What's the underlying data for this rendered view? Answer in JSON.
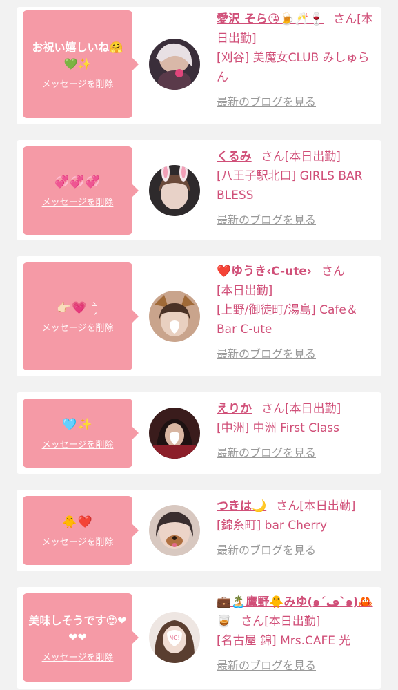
{
  "common": {
    "delete_label": "メッセージを削除",
    "blog_label": "最新のブログを見る",
    "san": "さん"
  },
  "colors": {
    "bubble": "#f59aa6",
    "text_pink": "#d04f78",
    "link_gray": "#9a9a9a",
    "background": "#f2f2f2"
  },
  "items": [
    {
      "message": "お祝い嬉しいね🤗💚✨",
      "name": "愛沢 そら😘🍺🥂🍷",
      "line2": "[本日出勤]",
      "line3": "[刈谷] 美魔女CLUB みしゅらん"
    },
    {
      "message": "💞💞💞",
      "name": "くるみ",
      "line2": "[本日出勤]",
      "line3": "[八王子駅北口] GIRLS BAR BLESS"
    },
    {
      "message": "👉🏻💗 ⁻̗̀",
      "name": "❤️ゆうき‹C-ute›",
      "line2": "[本日出勤]",
      "line3": "[上野/御徒町/湯島] Cafe＆Bar C-ute"
    },
    {
      "message": "🩵✨",
      "name": "えりか",
      "line2": "[本日出勤]",
      "line3": "[中洲] 中洲 First Class"
    },
    {
      "message": "🐥❤️",
      "name": "つきは🌙",
      "line2": "[本日出勤]",
      "line3": "[錦糸町] bar Cherry"
    },
    {
      "message": "美味しそうです😍❤❤❤",
      "name": "💼🏝️鷹野🐥みゆ(๑´ڡ`๑)🦀🥃",
      "line2": "[本日出勤]",
      "line3": "[名古屋 錦] Mrs.CAFE 光"
    }
  ]
}
